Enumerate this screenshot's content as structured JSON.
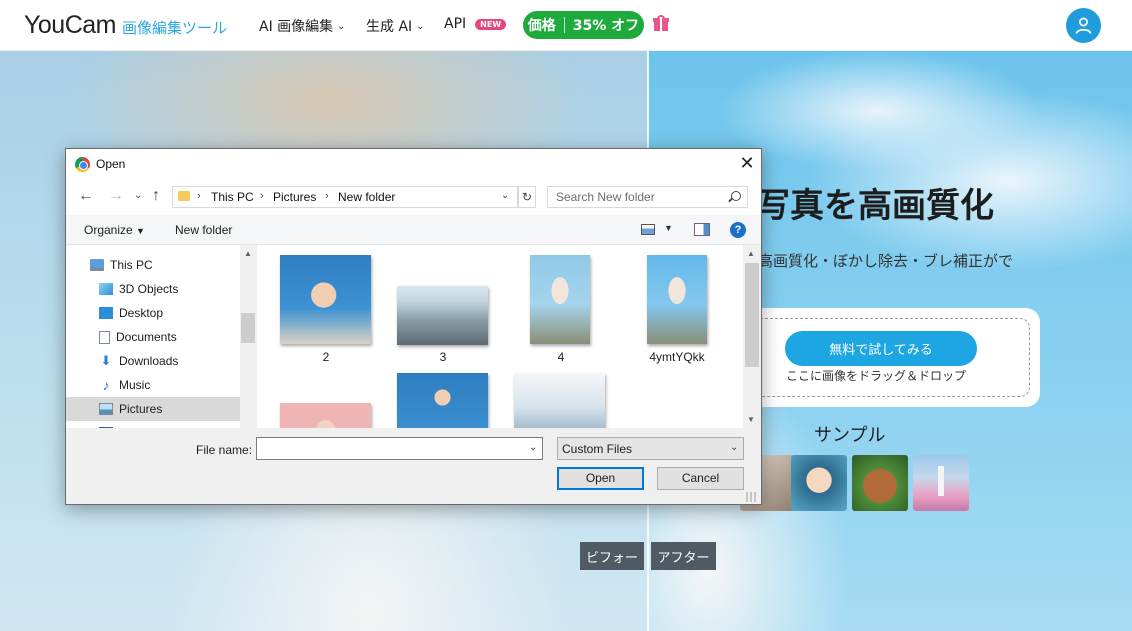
{
  "nav": {
    "logo": "YouCam",
    "logo_sub": "画像編集ツール",
    "items": [
      {
        "label": "AI 画像編集"
      },
      {
        "label": "生成 AI"
      },
      {
        "label": "API",
        "badge": "NEW"
      }
    ],
    "price_label": "価格",
    "price_discount": "35% オフ"
  },
  "hero": {
    "title": "写真を高画質化",
    "description": "高画質化・ぼかし除去・ブレ補正がで",
    "try_button": "無料で試してみる",
    "drop_text": "ここに画像をドラッグ＆ドロップ",
    "sample_label": "サンプル",
    "before_label": "ビフォー",
    "after_label": "アフター"
  },
  "dialog": {
    "title": "Open",
    "breadcrumb": [
      "This PC",
      "Pictures",
      "New folder"
    ],
    "search_placeholder": "Search New folder",
    "organize_label": "Organize",
    "new_folder_label": "New folder",
    "help_label": "?",
    "tree": [
      {
        "label": "This PC",
        "icon": "pc-icon"
      },
      {
        "label": "3D Objects",
        "icon": "cube-icon"
      },
      {
        "label": "Desktop",
        "icon": "desktop-icon"
      },
      {
        "label": "Documents",
        "icon": "document-icon"
      },
      {
        "label": "Downloads",
        "icon": "download-icon"
      },
      {
        "label": "Music",
        "icon": "music-icon"
      },
      {
        "label": "Pictures",
        "icon": "pictures-icon",
        "selected": true
      }
    ],
    "files": [
      {
        "name": "2"
      },
      {
        "name": "3"
      },
      {
        "name": "4"
      },
      {
        "name": "4ymtYQkk"
      }
    ],
    "file_name_label": "File name:",
    "file_name_value": "",
    "file_type": "Custom Files",
    "open_button": "Open",
    "cancel_button": "Cancel"
  },
  "colors": {
    "brand_blue": "#29a8e0",
    "price_green": "#1fab3c",
    "badge_pink": "#e6477c",
    "try_button_blue": "#1ea6e3"
  }
}
